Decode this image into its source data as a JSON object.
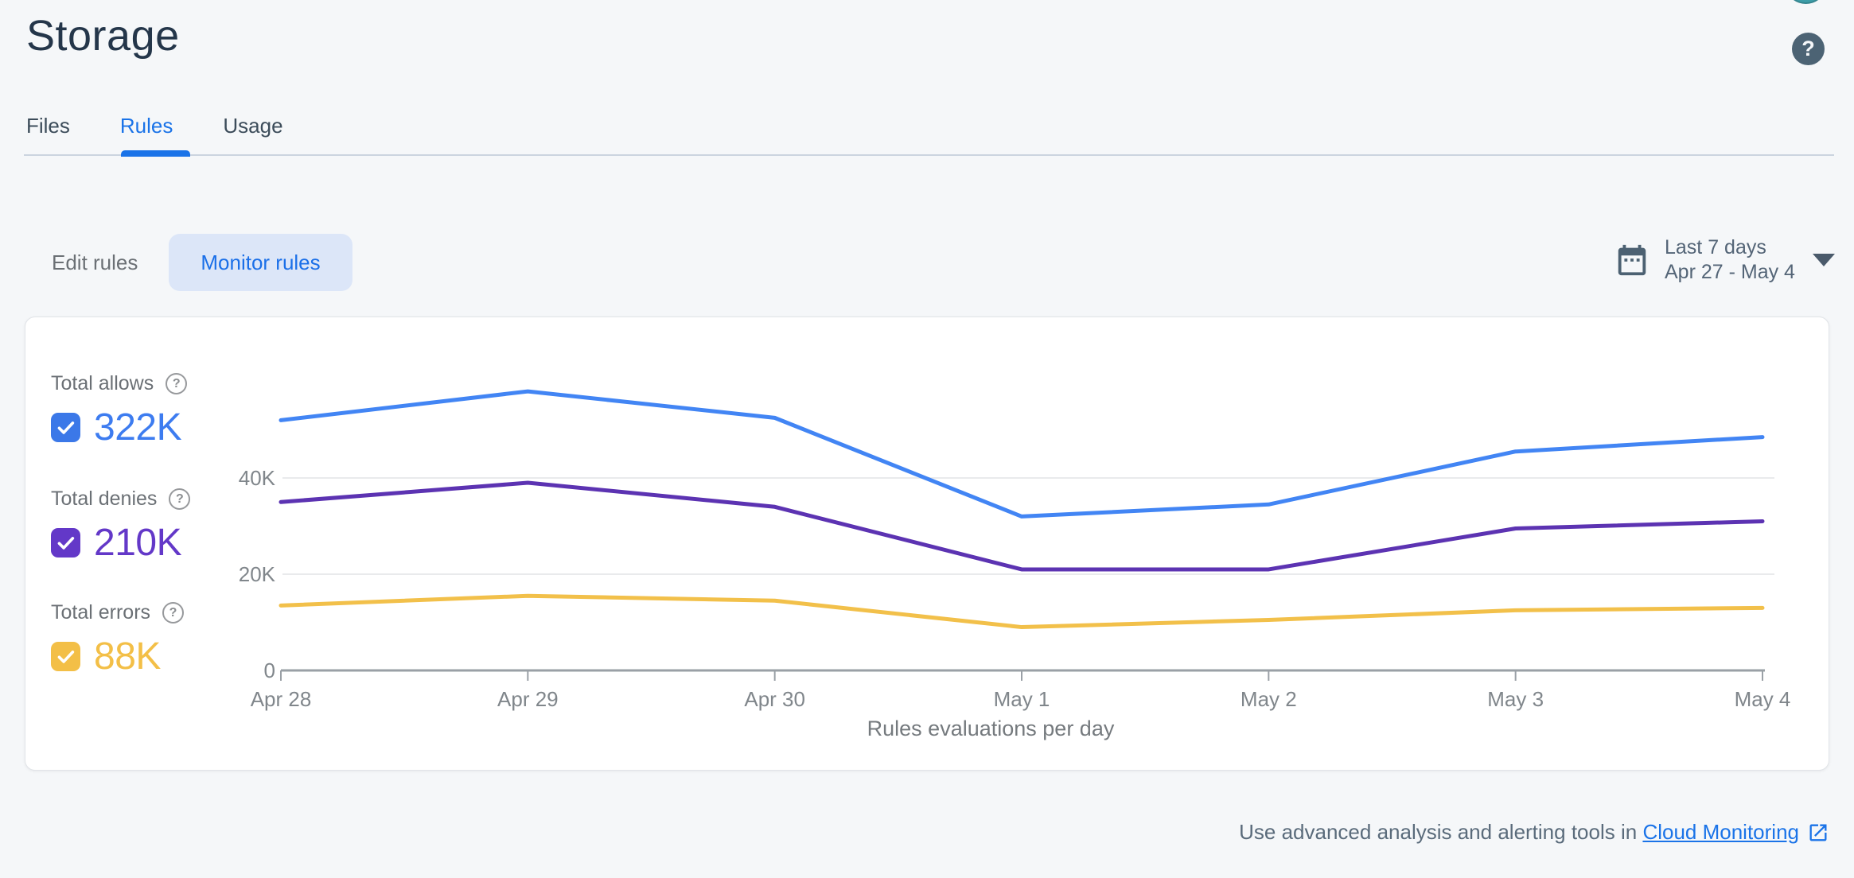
{
  "header": {
    "title": "Storage"
  },
  "icons": {
    "help_glyph": "?"
  },
  "tabs": [
    {
      "label": "Files",
      "active": false
    },
    {
      "label": "Rules",
      "active": true
    },
    {
      "label": "Usage",
      "active": false
    }
  ],
  "controls": {
    "edit_rules_label": "Edit rules",
    "monitor_rules_label": "Monitor rules",
    "date_range": {
      "label": "Last 7 days",
      "range": "Apr 27 - May 4"
    }
  },
  "legend": [
    {
      "label": "Total allows",
      "value": "322K",
      "checkbox_color": "#3b78e8",
      "value_color": "#3d7cf0",
      "checked": true
    },
    {
      "label": "Total denies",
      "value": "210K",
      "checkbox_color": "#6338c8",
      "value_color": "#6338c8",
      "checked": true
    },
    {
      "label": "Total errors",
      "value": "88K",
      "checkbox_color": "#f3bf47",
      "value_color": "#f3bf47",
      "checked": true
    }
  ],
  "chart_data": {
    "type": "line",
    "title": "Rules evaluations per day",
    "categories": [
      "Apr 28",
      "Apr 29",
      "Apr 30",
      "May 1",
      "May 2",
      "May 3",
      "May 4"
    ],
    "series": [
      {
        "name": "Total allows",
        "color": "#4285f4",
        "values": [
          52000,
          58000,
          52500,
          32000,
          34500,
          45500,
          48500
        ]
      },
      {
        "name": "Total denies",
        "color": "#5c33b2",
        "values": [
          35000,
          39000,
          34000,
          21000,
          21000,
          29500,
          31000
        ]
      },
      {
        "name": "Total errors",
        "color": "#f2c04a",
        "values": [
          13500,
          15500,
          14500,
          9000,
          10500,
          12500,
          13000
        ]
      }
    ],
    "yticks": [
      {
        "value": 0,
        "label": "0"
      },
      {
        "value": 20000,
        "label": "20K"
      },
      {
        "value": 40000,
        "label": "40K"
      }
    ],
    "ylim": [
      0,
      62000
    ],
    "grid": "horizontal",
    "legend_position": "left",
    "axis_color": "#9aa0a6",
    "grid_color": "#e9eaec",
    "tick_label_color": "#80868b"
  },
  "footer": {
    "text": "Use advanced analysis and alerting tools in ",
    "link_label": "Cloud Monitoring"
  }
}
